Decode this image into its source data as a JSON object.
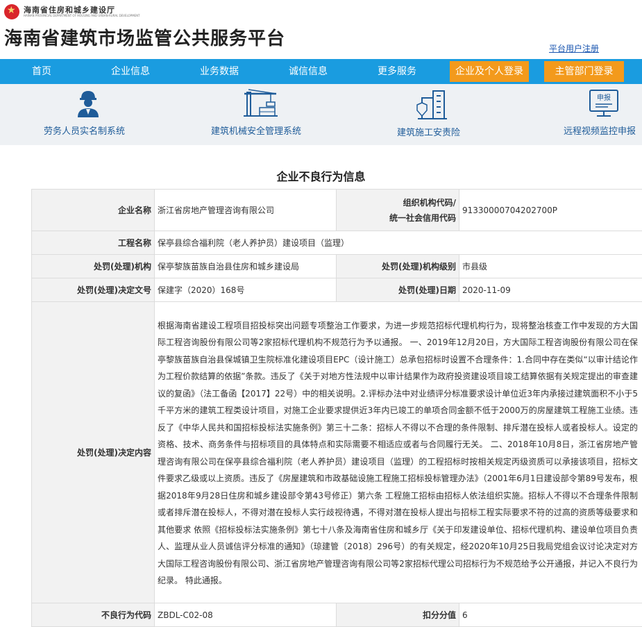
{
  "header": {
    "department": "海南省住房和城乡建设厅",
    "department_en": "HAINAN PROVINCIAL DEPARTMENT OF HOUSING AND URBAN-RURAL DEVELOPMENT",
    "site_title": "海南省建筑市场监管公共服务平台",
    "register_link": "平台用户注册"
  },
  "nav": {
    "items": [
      "首页",
      "企业信息",
      "业务数据",
      "诚信信息",
      "更多服务"
    ],
    "login_company": "企业及个人登录",
    "login_admin": "主管部门登录"
  },
  "systems": [
    {
      "label": "劳务人员实名制系统",
      "icon": "worker-icon"
    },
    {
      "label": "建筑机械安全管理系统",
      "icon": "crane-icon"
    },
    {
      "label": "建筑施工安责险",
      "icon": "building-insurance-icon"
    },
    {
      "label": "远程视频监控申报",
      "icon": "monitor-report-icon"
    }
  ],
  "page_heading": "企业不良行为信息",
  "record": {
    "company_name_label": "企业名称",
    "company_name": "浙江省房地产管理咨询有限公司",
    "org_code_label_1": "组织机构代码/",
    "org_code_label_2": "统一社会信用代码",
    "org_code": "91330000704202700P",
    "project_label": "工程名称",
    "project": "保亭县综合福利院（老人养护员）建设项目（监理）",
    "authority_label": "处罚(处理)机构",
    "authority": "保亭黎族苗族自治县住房和城乡建设局",
    "authority_level_label": "处罚(处理)机构级别",
    "authority_level": "市县级",
    "doc_no_label": "处罚(处理)决定文号",
    "doc_no": "保建字（2020）168号",
    "date_label": "处罚(处理)日期",
    "date": "2020-11-09",
    "content_label": "处罚(处理)决定内容",
    "content": "根据海南省建设工程项目招投标突出问题专项整治工作要求，为进一步规范招标代理机构行为，现将整治核查工作中发现的方大国际工程咨询股份有限公司等2家招标代理机构不规范行为予以通报。 一、2019年12月20日，方大国际工程咨询股份有限公司在保亭黎族苗族自治县保城镇卫生院标准化建设项目EPC（设计施工）总承包招标时设置不合理条件：1.合同中存在类似“以审计结论作为工程价款结算的依据”条款。违反了《关于对地方性法规中以审计结果作为政府投资建设项目竣工结算依据有关规定提出的审查建议的复函》（法工备函【2017】22号）中的相关说明。2.评标办法中对业绩评分标准要求设计单位近3年内承接过建筑面积不小于5千平方米的建筑工程类设计项目，对施工企业要求提供近3年内已竣工的单项合同金额不低于2000万的房屋建筑工程施工业绩。违反了《中华人民共和国招标投标法实施条例》第三十二条：招标人不得以不合理的条件限制、排斥潜在投标人或者投标人。设定的资格、技术、商务条件与招标项目的具体特点和实际需要不相适应或者与合同履行无关。 二、2018年10月8日，浙江省房地产管理咨询有限公司在保亭县综合福利院（老人养护员）建设项目（监理）的工程招标时按相关规定丙级资质可以承接该项目，招标文件要求乙级或以上资质。违反了《房屋建筑和市政基础设施工程施工招标投标管理办法》（2001年6月1日建设部令第89号发布，根据2018年9月28日住房和城乡建设部令第43号修正）第六条 工程施工招标由招标人依法组织实施。招标人不得以不合理条件限制或者排斥潜在投标人，不得对潜在投标人实行歧视待遇，不得对潜在投标人提出与招标工程实际要求不符的过高的资质等级要求和其他要求 依照《招标投标法实施条例》第七十八条及海南省住房和城乡厅《关于印发建设单位、招标代理机构、建设单位项目负责人、监理从业人员诚信评分标准的通知》（琼建管〔2018〕296号）的有关规定，经2020年10月25日我局党组会议讨论决定对方大国际工程咨询股份有限公司、浙江省房地产管理咨询有限公司等2家招标代理公司招标行为不规范给予公开通报，并记入不良行为纪录。 特此通报。",
    "code_label": "不良行为代码",
    "code": "ZBDL-C02-08",
    "score_label": "扣分分值",
    "score": "6"
  },
  "colors": {
    "nav_bg": "#1a9ce0",
    "login_btn": "#f39a1c",
    "link": "#1a56b0"
  }
}
